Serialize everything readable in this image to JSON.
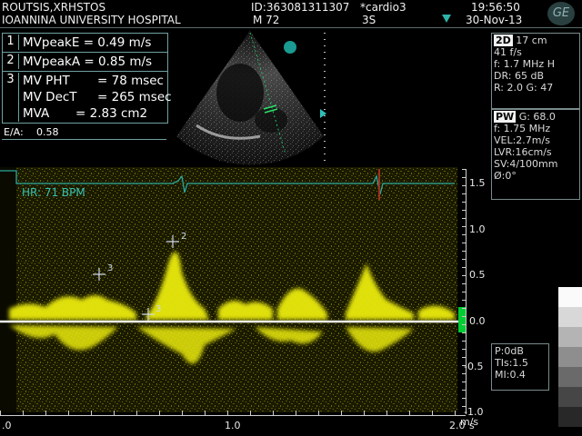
{
  "header": {
    "patient_name": "ROUTSIS,XRHSTOS",
    "hospital": "IOANNINA UNIVERSITY HOSPITAL",
    "patient_id": "ID:363081311307",
    "sex_age": "M 72",
    "preset": "*cardio3",
    "probe": "3S",
    "time": "19:56:50",
    "date": "30-Nov-13",
    "logo": "GE"
  },
  "measurements": {
    "rows": [
      {
        "num": "1",
        "label": "MVpeakE",
        "value": "= 0.49 m/s"
      },
      {
        "num": "2",
        "label": "MVpeakA",
        "value": "= 0.85 m/s"
      },
      {
        "num": "3",
        "label": "MV PHT",
        "value": "= 78 msec"
      },
      {
        "num": "",
        "label": "MV DecT",
        "value": "= 265 msec"
      },
      {
        "num": "",
        "label": "MVA",
        "value": "= 2.83 cm2"
      }
    ],
    "ea_label": "E/A:",
    "ea_value": "0.58"
  },
  "panel_2d": {
    "tag": "2D",
    "depth": "17 cm",
    "frame_rate": "41 f/s",
    "freq": "f: 1.7 MHz H",
    "dr": "DR: 65 dB",
    "r_g": "R: 2.0   G: 47"
  },
  "panel_pw": {
    "tag": "PW",
    "gain": "G: 68.0",
    "freq": "f: 1.75 MHz",
    "vel": "VEL:2.7m/s",
    "lvr": "LVR:16cm/s",
    "sv": "SV:4/100mm",
    "angle": "Ø:0°"
  },
  "panel_power": {
    "p": "P:0dB",
    "tis": "TIs:1.5",
    "mi": "MI:0.4"
  },
  "doppler": {
    "hr_text": "HR: 71 BPM",
    "y_axis_ticks": [
      "1.5",
      "1.0",
      "0.5",
      "0.0",
      "-0.5",
      "-1.0"
    ],
    "y_unit": "m/s",
    "x_axis_ticks": [
      ".0",
      "1.0",
      "2.0"
    ],
    "x_unit": "s",
    "caliper_labels": [
      "2",
      "3",
      "3"
    ]
  },
  "colors": {
    "doppler_signal": "#e6e600",
    "ecg_trace": "#2aa89a",
    "baseline_marker": "#00cc33",
    "caliper": "#cfd8e8",
    "panel_border": "#7a8a8a"
  }
}
